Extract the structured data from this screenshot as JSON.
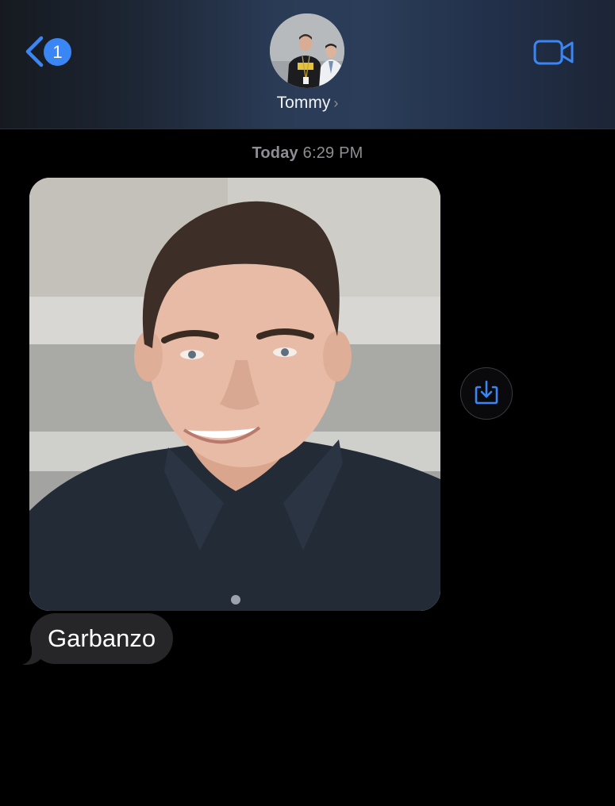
{
  "header": {
    "back_badge_count": "1",
    "contact_name": "Tommy",
    "name_chevron": "›",
    "back_icon": "chevron-left-icon",
    "video_icon": "video-camera-icon",
    "accent_color": "#3a86f5"
  },
  "conversation": {
    "timestamp_day": "Today",
    "timestamp_time": "6:29 PM",
    "messages": [
      {
        "kind": "image",
        "content": "portrait photo",
        "save_icon": "save-download-icon"
      },
      {
        "kind": "text",
        "text": "Garbanzo"
      }
    ]
  },
  "colors": {
    "background": "#000000",
    "incoming_bubble": "#262629",
    "timestamp_text": "#8e8e93"
  }
}
